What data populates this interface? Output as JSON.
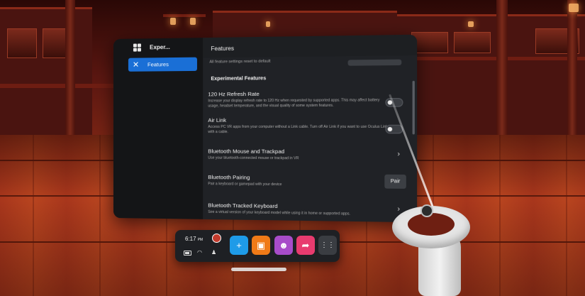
{
  "nav": {
    "title": "Exper...",
    "items": [
      {
        "label": "Features",
        "icon": "features-icon",
        "selected": true
      }
    ]
  },
  "content": {
    "title": "Features",
    "reset_text": "All feature settings reset to default",
    "section_title": "Experimental Features",
    "rows": [
      {
        "title": "120 Hz Refresh Rate",
        "description": "Increase your display refresh rate to 120 Hz when requested by supported apps. This may affect battery usage, headset temperature, and the visual quality of some system features.",
        "control": "toggle",
        "on": false
      },
      {
        "title": "Air Link",
        "description": "Access PC VR apps from your computer without a Link cable. Turn off Air Link if you want to use Oculus Link with a cable.",
        "control": "toggle",
        "on": false
      },
      {
        "title": "Bluetooth Mouse and Trackpad",
        "description": "Use your bluetooth-connected mouse or trackpad in VR",
        "control": "chevron"
      },
      {
        "title": "Bluetooth Pairing",
        "description": "Pair a keyboard or gamepad with your device",
        "control": "button",
        "button_label": "Pair"
      },
      {
        "title": "Bluetooth Tracked Keyboard",
        "description": "See a virtual version of your keyboard model while using it in home or supported apps.",
        "control": "chevron"
      }
    ]
  },
  "dock": {
    "time": "6:17",
    "ampm": "PM",
    "apps": [
      {
        "name": "explore",
        "icon": "plus-icon",
        "color": "#1e9be8"
      },
      {
        "name": "store",
        "icon": "shopping-bag-icon",
        "color": "#f07a17"
      },
      {
        "name": "people",
        "icon": "people-icon",
        "color": "#a84cc9"
      },
      {
        "name": "share",
        "icon": "share-arrow-icon",
        "color": "#e83b6f"
      },
      {
        "name": "app-library",
        "icon": "grid-icon",
        "color": "#3a3d42"
      }
    ]
  },
  "icons": {
    "chevron": "›",
    "features": "✕",
    "plus": "+",
    "bag": "▣",
    "people": "☻",
    "share": "➦",
    "grid": "⋮⋮",
    "wifi": "◠",
    "bell": "♟"
  }
}
